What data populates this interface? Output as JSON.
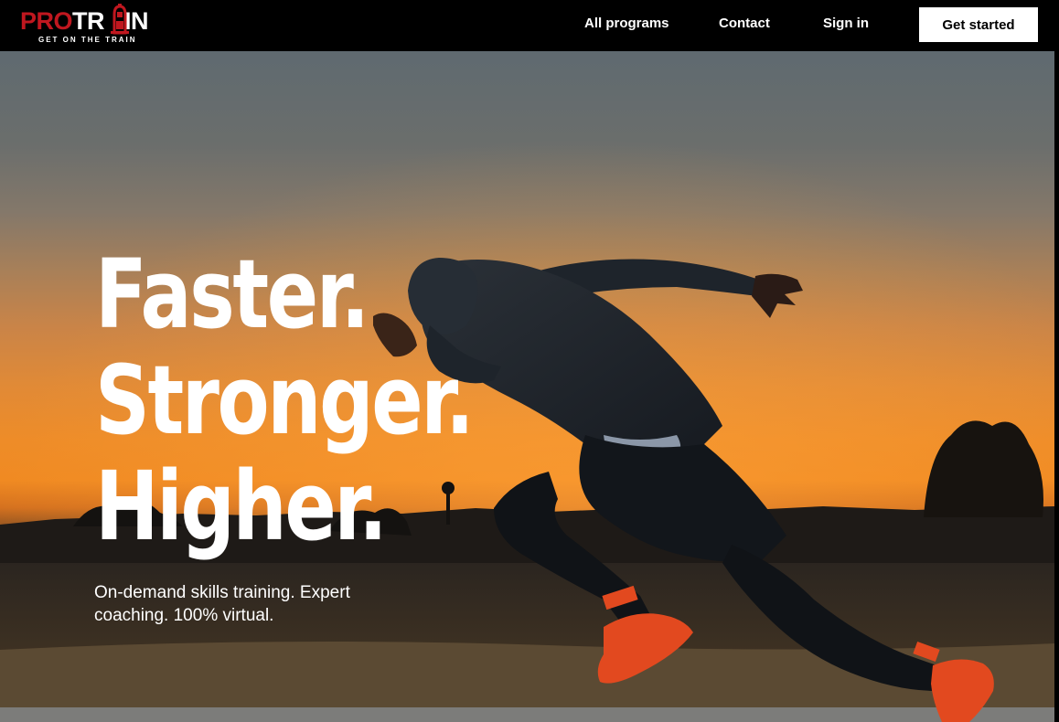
{
  "brand": {
    "logo_word_red": "PRO",
    "logo_word_white_1": "TR",
    "logo_word_white_2": "IN",
    "tagline": "GET ON THE TRAIN",
    "accent_color": "#c0171f"
  },
  "nav": {
    "links": [
      {
        "label": "All programs"
      },
      {
        "label": "Contact"
      },
      {
        "label": "Sign in"
      }
    ],
    "cta_label": "Get started"
  },
  "hero": {
    "headline": [
      "Faster.",
      "Stronger.",
      "Higher."
    ],
    "subcopy": "On-demand skills training. Expert coaching. 100% virtual."
  }
}
